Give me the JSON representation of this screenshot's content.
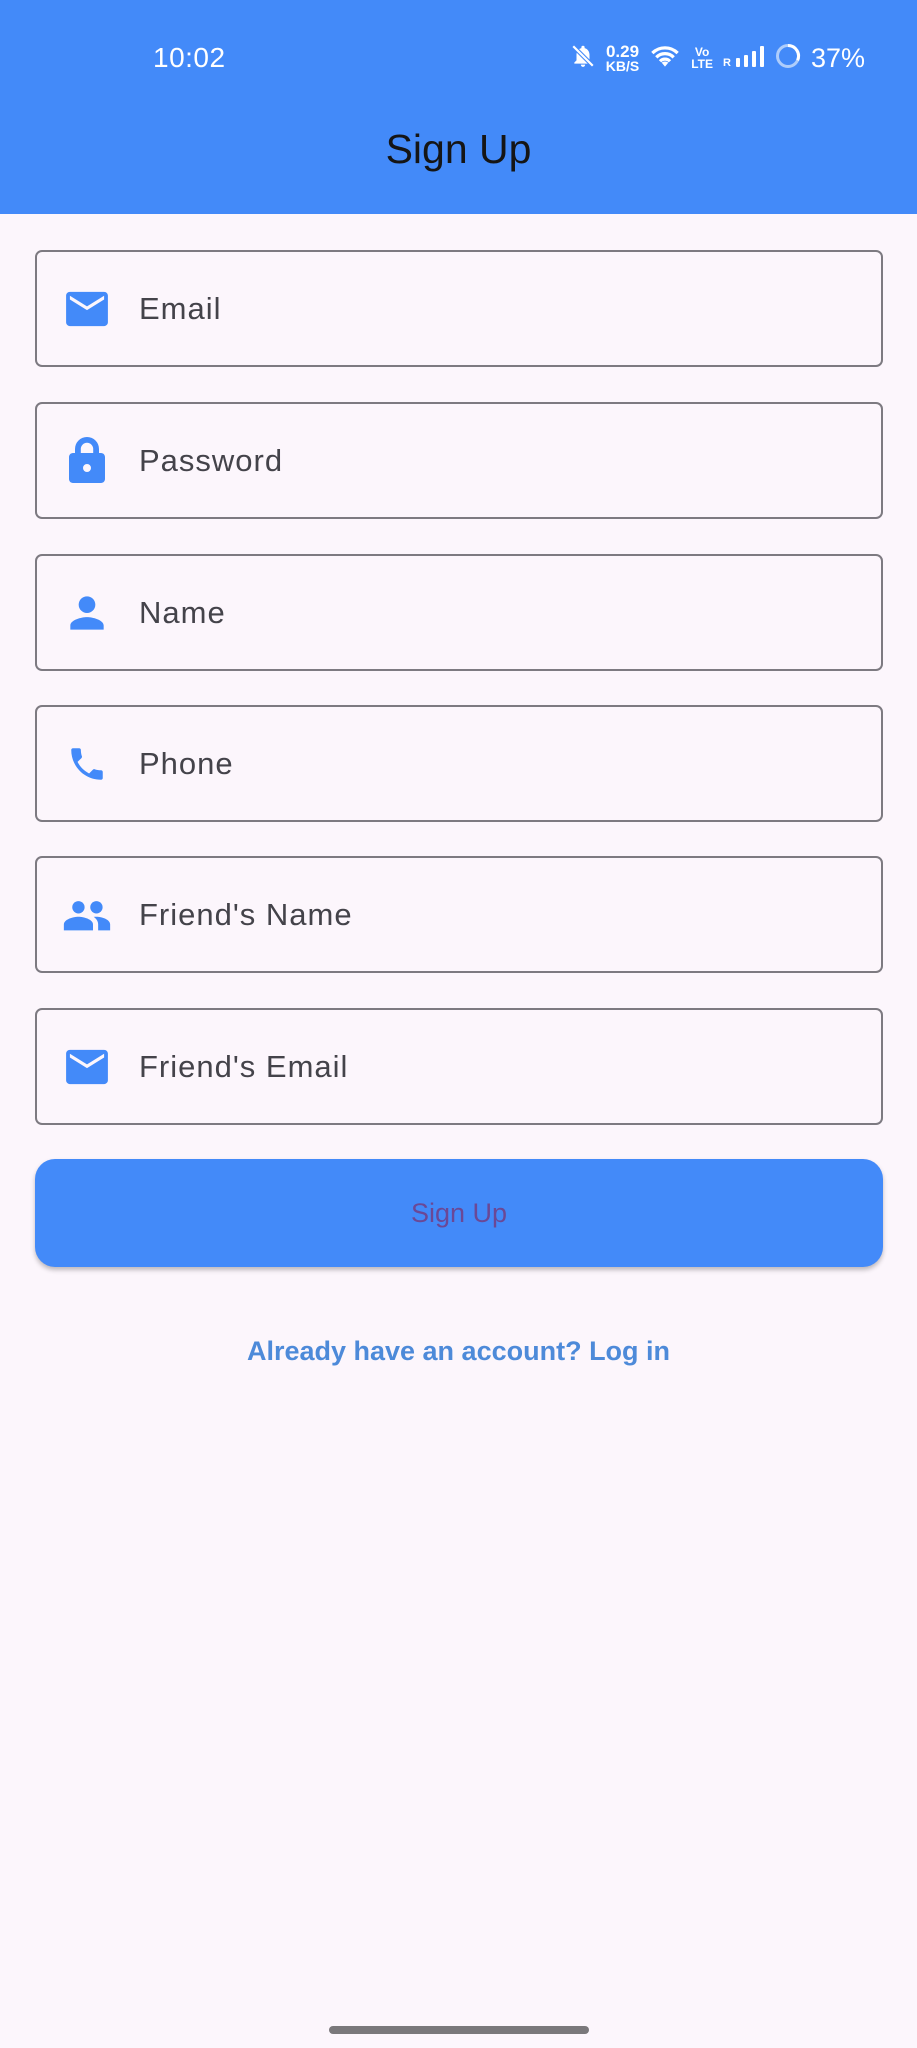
{
  "status_bar": {
    "time": "10:02",
    "net_speed_value": "0.29",
    "net_speed_unit": "KB/S",
    "volte_top": "Vo",
    "volte_bottom": "LTE",
    "roaming": "R",
    "battery": "37%",
    "icons": [
      "bell-off-icon",
      "wifi-icon",
      "signal-icon",
      "battery-icon"
    ]
  },
  "app_bar": {
    "title": "Sign Up",
    "color": "#438af9"
  },
  "form": {
    "fields": [
      {
        "icon": "email-icon",
        "placeholder": "Email",
        "value": ""
      },
      {
        "icon": "lock-icon",
        "placeholder": "Password",
        "value": ""
      },
      {
        "icon": "person-icon",
        "placeholder": "Name",
        "value": ""
      },
      {
        "icon": "phone-icon",
        "placeholder": "Phone",
        "value": ""
      },
      {
        "icon": "group-icon",
        "placeholder": "Friend's Name",
        "value": ""
      },
      {
        "icon": "email-icon",
        "placeholder": "Friend's Email",
        "value": ""
      }
    ],
    "icon_color": "#438af9",
    "submit_label": "Sign Up",
    "login_link": "Already have an account? Log in"
  }
}
